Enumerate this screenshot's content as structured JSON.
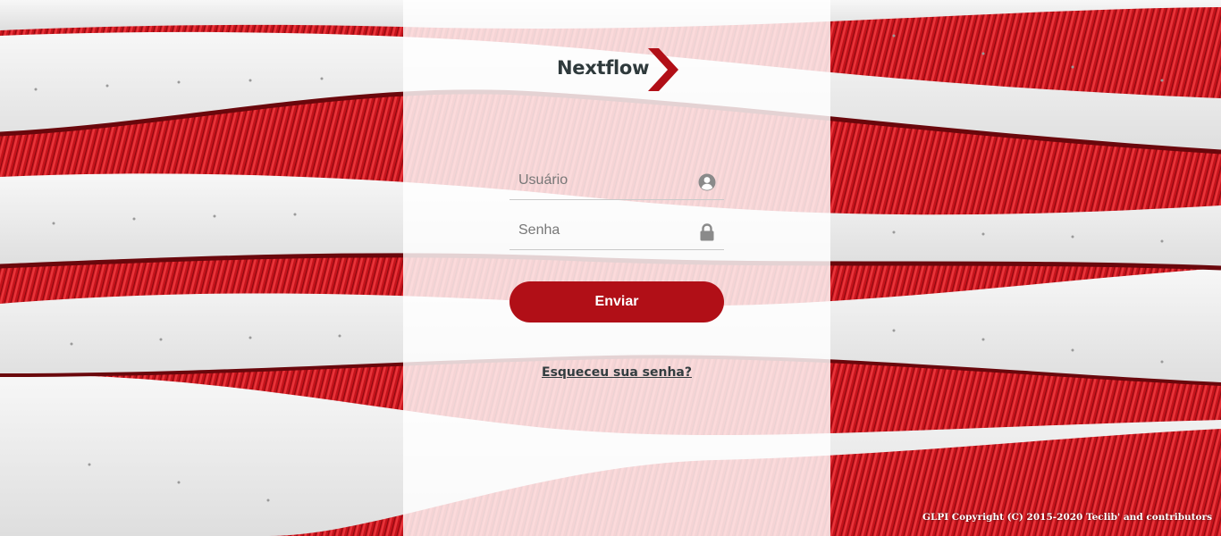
{
  "brand": {
    "name": "Nextflow",
    "accent_color": "#b10f17",
    "logo_icon": "chevron-right-icon"
  },
  "login": {
    "username": {
      "placeholder": "Usuário",
      "icon": "user-circle-icon"
    },
    "password": {
      "placeholder": "Senha",
      "icon": "lock-icon"
    },
    "submit_label": "Enviar",
    "forgot_link": "Esqueceu sua senha?"
  },
  "footer": {
    "copyright": "GLPI Copyright (C) 2015-2020 Teclib' and contributors"
  }
}
